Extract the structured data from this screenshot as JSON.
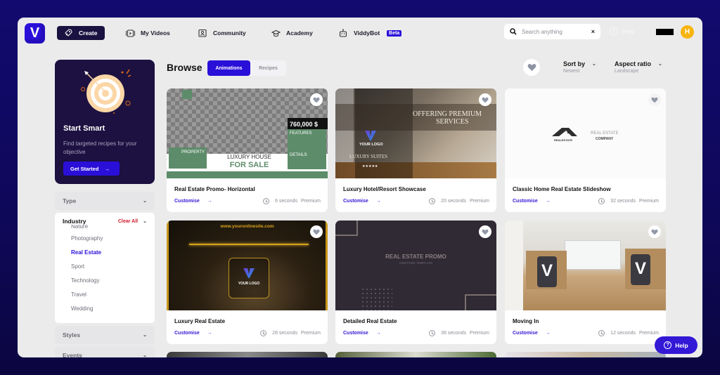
{
  "nav": {
    "logo": "V",
    "items": [
      {
        "label": "Create",
        "icon": "rocket-icon"
      },
      {
        "label": "My Videos",
        "icon": "video-icon"
      },
      {
        "label": "Community",
        "icon": "community-icon"
      },
      {
        "label": "Academy",
        "icon": "graduation-cap-icon"
      },
      {
        "label": "ViddyBot",
        "icon": "robot-icon",
        "badge": "Beta"
      }
    ],
    "search": {
      "placeholder": "Search anything",
      "value": "",
      "clear": "×"
    },
    "help": "Help",
    "avatar_initial": "H"
  },
  "sidebar": {
    "promo": {
      "title": "Start Smart",
      "text": "Find targeted recipes for your objective",
      "button": "Get Started"
    },
    "filters": {
      "type": "Type",
      "industry": {
        "label": "Industry",
        "clear": "Clear All",
        "options": [
          {
            "label": "Nature",
            "active": false
          },
          {
            "label": "Photography",
            "active": false
          },
          {
            "label": "Real Estate",
            "active": true
          },
          {
            "label": "Sport",
            "active": false
          },
          {
            "label": "Technology",
            "active": false
          },
          {
            "label": "Travel",
            "active": false
          },
          {
            "label": "Wedding",
            "active": false
          }
        ]
      },
      "styles": "Styles",
      "events": "Events"
    }
  },
  "browse": {
    "title": "Browse",
    "tabs": [
      {
        "label": "Animations",
        "active": true
      },
      {
        "label": "Recipes",
        "active": false
      }
    ],
    "sort": {
      "label": "Sort by",
      "value": "Newest"
    },
    "aspect": {
      "label": "Aspect ratio",
      "value": "Landscape"
    }
  },
  "cards": [
    {
      "title": "Real Estate Promo- Horizontal",
      "action": "Customise",
      "duration": "6 seconds",
      "tier": "Premium",
      "thumb": {
        "price": "760,000 $",
        "features": "FEATURES",
        "details": "DETAILS",
        "property": "PROPERTY",
        "headline1": "LUXURY HOUSE",
        "headline2": "FOR SALE"
      }
    },
    {
      "title": "Luxury Hotel/Resort Showcase",
      "action": "Customise",
      "duration": "20 seconds",
      "tier": "Premium",
      "thumb": {
        "line1": "OFFERING PREMIUM",
        "line2": "SERVICES",
        "logo": "YOUR LOGO",
        "suites": "LUXURY SUITES",
        "stars": "★★★★★"
      }
    },
    {
      "title": "Classic Home Real Estate Slideshow",
      "action": "Customise",
      "duration": "32 seconds",
      "tier": "Premium",
      "thumb": {
        "mark": "REALESTATE",
        "line1": "REAL ESTATE",
        "line2": "COMPANY"
      }
    },
    {
      "title": "Luxury Real Estate",
      "action": "Customise",
      "duration": "28 seconds",
      "tier": "Premium",
      "thumb": {
        "url": "www.youronlinesite.com",
        "logo": "YOUR LOGO"
      }
    },
    {
      "title": "Detailed Real Estate",
      "action": "Customise",
      "duration": "36 seconds",
      "tier": "Premium",
      "thumb": {
        "line1": "REAL ESTATE PROMO",
        "line2": "VIDDYOZE TEMPLATE"
      }
    },
    {
      "title": "Moving In",
      "action": "Customise",
      "duration": "12 seconds",
      "tier": "Premium",
      "thumb": {
        "box_letter": "V"
      }
    }
  ],
  "help_fab": "Help",
  "colors": {
    "brand": "#2a0fd9",
    "accent_link": "#3318d6",
    "clear": "#d0182a",
    "avatar": "#f8b50f",
    "promo_bg": "#1c1140"
  }
}
